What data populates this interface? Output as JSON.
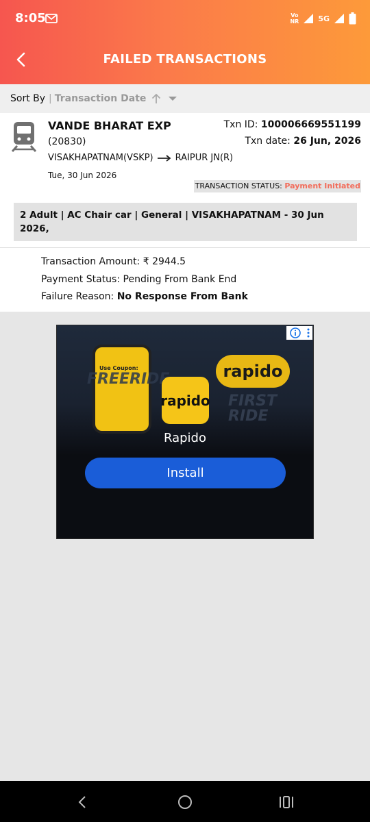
{
  "status_bar": {
    "time": "8:05",
    "volte_top": "Vo",
    "volte_bottom": "NR",
    "network": "5G"
  },
  "app_bar": {
    "title": "FAILED TRANSACTIONS"
  },
  "sort": {
    "label": "Sort By",
    "separator": "|",
    "value": "Transaction Date"
  },
  "transaction": {
    "train_name": "VANDE BHARAT EXP",
    "train_number": "(20830)",
    "from": "VISAKHAPATNAM(VSKP)",
    "to": "RAIPUR JN(R)",
    "journey_date": "Tue, 30 Jun 2026",
    "txn_id_label": "Txn ID: ",
    "txn_id": "100006669551199",
    "txn_date_label": "Txn date: ",
    "txn_date": "26 Jun, 2026",
    "status_label": "TRANSACTION STATUS: ",
    "status_value": "Payment Initiated",
    "summary": "2 Adult | AC Chair car | General | VISAKHAPATNAM - 30 Jun 2026,",
    "amount_label": "Transaction Amount: ",
    "amount": "₹ 2944.5",
    "payment_status_label": "Payment Status: ",
    "payment_status": "Pending From Bank End",
    "failure_reason_label": "Failure Reason: ",
    "failure_reason": "No Response From Bank"
  },
  "ad": {
    "coupon_text": "Use Coupon:",
    "promo_left": "FREERIDE",
    "pill_text": "rapido",
    "promo_right_1": "FIRST",
    "promo_right_2": "RIDE",
    "logo_text": "rapido",
    "app_name": "Rapido",
    "install_label": "Install"
  },
  "colors": {
    "header_gradient_start": "#f6564f",
    "header_gradient_end": "#fd9a3a",
    "status_failed": "#f26c5a",
    "install_button": "#1a5dd8",
    "rapido_yellow": "#f5c518"
  }
}
